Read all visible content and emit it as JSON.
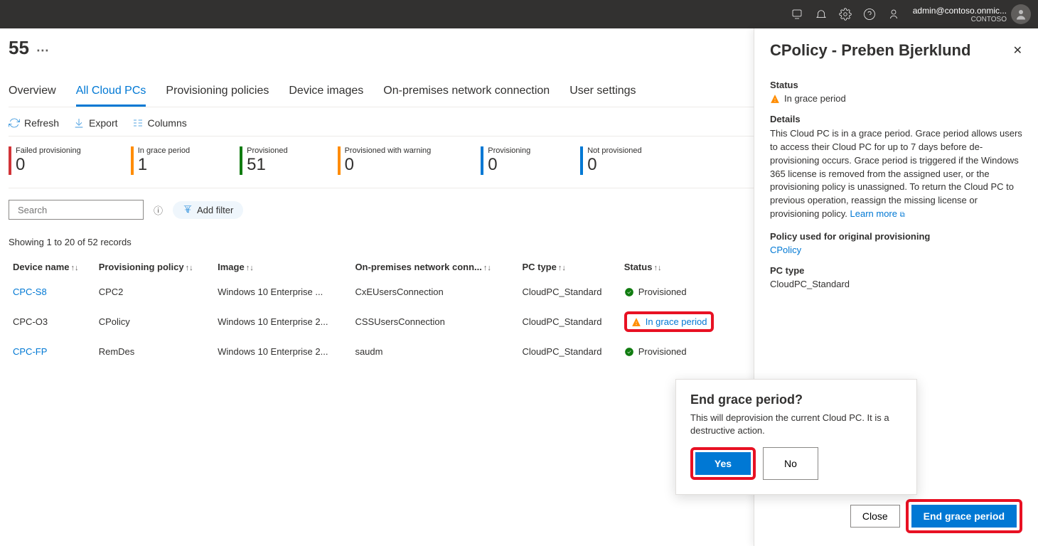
{
  "topbar": {
    "user_email": "admin@contoso.onmic...",
    "tenant": "CONTOSO"
  },
  "page": {
    "title_suffix": "55",
    "more_label": "..."
  },
  "tabs": {
    "items": [
      {
        "label": "Overview"
      },
      {
        "label": "All Cloud PCs"
      },
      {
        "label": "Provisioning policies"
      },
      {
        "label": "Device images"
      },
      {
        "label": "On-premises network connection"
      },
      {
        "label": "User settings"
      }
    ],
    "active_index": 1
  },
  "toolbar": {
    "refresh": "Refresh",
    "export": "Export",
    "columns": "Columns"
  },
  "stats": [
    {
      "label": "Failed provisioning",
      "value": "0",
      "color": "red"
    },
    {
      "label": "In grace period",
      "value": "1",
      "color": "orange"
    },
    {
      "label": "Provisioned",
      "value": "51",
      "color": "green"
    },
    {
      "label": "Provisioned with warning",
      "value": "0",
      "color": "orange"
    },
    {
      "label": "Provisioning",
      "value": "0",
      "color": "blue"
    },
    {
      "label": "Not provisioned",
      "value": "0",
      "color": "blue"
    }
  ],
  "search": {
    "placeholder": "Search",
    "add_filter": "Add filter"
  },
  "records_text": "Showing 1 to 20 of 52 records",
  "columns": {
    "device_name": "Device name",
    "provisioning_policy": "Provisioning policy",
    "image": "Image",
    "opnc": "On-premises network conn...",
    "pc_type": "PC type",
    "status": "Status"
  },
  "rows": [
    {
      "device": "CPC-S8",
      "policy": "CPC2",
      "image": "Windows 10 Enterprise ...",
      "conn": "CxEUsersConnection",
      "pctype": "CloudPC_Standard",
      "status": "Provisioned",
      "status_kind": "ok"
    },
    {
      "device": "CPC-O3",
      "policy": "CPolicy",
      "image": "Windows 10 Enterprise 2...",
      "conn": "CSSUsersConnection",
      "pctype": "CloudPC_Standard",
      "status": "In grace period",
      "status_kind": "warn"
    },
    {
      "device": "CPC-FP",
      "policy": "RemDes",
      "image": "Windows 10 Enterprise 2...",
      "conn": "saudm",
      "pctype": "CloudPC_Standard",
      "status": "Provisioned",
      "status_kind": "ok"
    }
  ],
  "panel": {
    "title": "CPolicy - Preben Bjerklund",
    "status_label": "Status",
    "status_value": "In grace period",
    "details_label": "Details",
    "details_text": "This Cloud PC is in a grace period. Grace period allows users to access their Cloud PC for up to 7 days before de-provisioning occurs. Grace period is triggered if the Windows 365 license is removed from the assigned user, or the provisioning policy is unassigned. To return the Cloud PC to previous operation, reassign the missing license or provisioning policy.",
    "learn_more": "Learn more",
    "policy_label": "Policy used for original provisioning",
    "policy_value": "CPolicy",
    "pctype_label": "PC type",
    "pctype_value": "CloudPC_Standard",
    "close_btn": "Close",
    "end_grace_btn": "End grace period"
  },
  "dialog": {
    "title": "End grace period?",
    "body": "This will deprovision the current Cloud PC. It is a destructive action.",
    "yes": "Yes",
    "no": "No"
  }
}
